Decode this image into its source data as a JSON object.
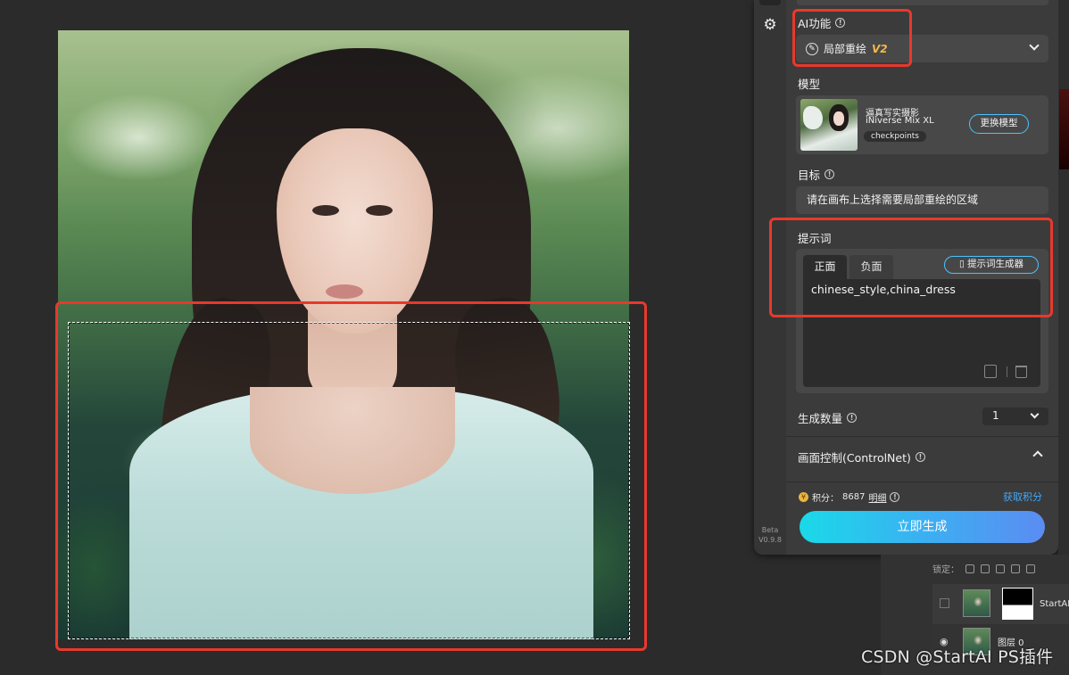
{
  "panel": {
    "ai_function": {
      "label": "AI功能",
      "selected": "局部重绘",
      "version": "V2"
    },
    "model": {
      "label": "模型",
      "name_line1": "逼真写实摄影",
      "name_line2": "iNiverse Mix XL",
      "tag": "checkpoints",
      "swap_button": "更换模型"
    },
    "target": {
      "label": "目标",
      "value": "请在画布上选择需要局部重绘的区域"
    },
    "prompt": {
      "label": "提示词",
      "tab_positive": "正面",
      "tab_negative": "负面",
      "generator_button": "提示词生成器",
      "value": "chinese_style,china_dress"
    },
    "generate_count": {
      "label": "生成数量",
      "value": "1"
    },
    "controlnet": {
      "label": "画面控制(ControlNet)"
    },
    "points": {
      "label": "积分：",
      "value": "8687",
      "detail": "明细",
      "get_link": "获取积分"
    },
    "generate_button": "立即生成",
    "version": {
      "beta": "Beta",
      "number": "V0.9.8"
    }
  },
  "layers": {
    "lock_label": "锁定：",
    "layer1_name": "StartAI",
    "layer2_name": "图层 0"
  },
  "watermark": "CSDN @StartAI PS插件",
  "colors": {
    "accent_blue": "#4cc2ff",
    "highlight_red": "#e8392b",
    "v2_gold": "#f0b94a",
    "panel_bg": "#3b3b3b"
  }
}
